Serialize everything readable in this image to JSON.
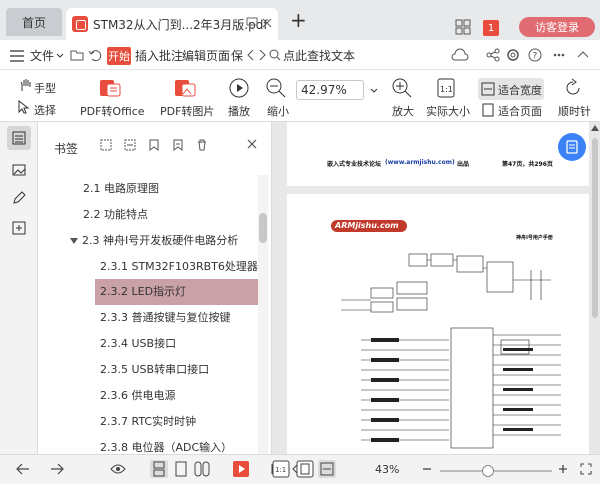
{
  "tabs": {
    "home_label": "首页",
    "doc_title": "STM32从入门到...2年3月版.pdf",
    "new_tab": "+",
    "badge_count": "1",
    "login_label": "访客登录"
  },
  "menu": {
    "file_label": "文件",
    "items": [
      "开始",
      "插入",
      "批注",
      "编辑",
      "页面",
      "保"
    ],
    "search_label": "点此查找文本"
  },
  "toolbar": {
    "hand_label": "手型",
    "select_label": "选择",
    "pdf_office_label": "PDF转Office",
    "pdf_image_label": "PDF转图片",
    "play_label": "播放",
    "zoom_out_label": "缩小",
    "zoom_value": "42.97%",
    "zoom_in_label": "放大",
    "actual_size_label": "实际大小",
    "fit_width_label": "适合宽度",
    "fit_page_label": "适合页面",
    "rotate_label": "顺时针"
  },
  "bookmarks": {
    "title": "书签",
    "items": [
      {
        "label": "2.1 电路原理图",
        "level": 1
      },
      {
        "label": "2.2 功能特点",
        "level": 1
      },
      {
        "label": "2.3 神舟I号开发板硬件电路分析",
        "level": 1,
        "expanded": true
      },
      {
        "label": "2.3.1 STM32F103RBT6处理器",
        "level": 2
      },
      {
        "label": "2.3.2 LED指示灯",
        "level": 2,
        "selected": true
      },
      {
        "label": "2.3.3 普通按键与复位按键",
        "level": 2
      },
      {
        "label": "2.3.4 USB接口",
        "level": 2
      },
      {
        "label": "2.3.5 USB转串口接口",
        "level": 2
      },
      {
        "label": "2.3.6 供电电源",
        "level": 2
      },
      {
        "label": "2.3.7 RTC实时时钟",
        "level": 2
      },
      {
        "label": "2.3.8 电位器（ADC输入）",
        "level": 2
      }
    ]
  },
  "document": {
    "header_left": "嵌入式专业技术论坛",
    "header_url": "(www.armjishu.com)",
    "header_mid": "出品",
    "header_right": "第47页，共296页",
    "logo_text": "ARMjishu.com",
    "page_tag": "神舟I号用户手册"
  },
  "status": {
    "zoom": "43%",
    "zoom_fraction": 0.43
  },
  "colors": {
    "accent_red": "#e74c3c",
    "selected_bookmark": "#c9a1a6",
    "login_pink": "#e06c72",
    "float_blue": "#3b82f6"
  }
}
